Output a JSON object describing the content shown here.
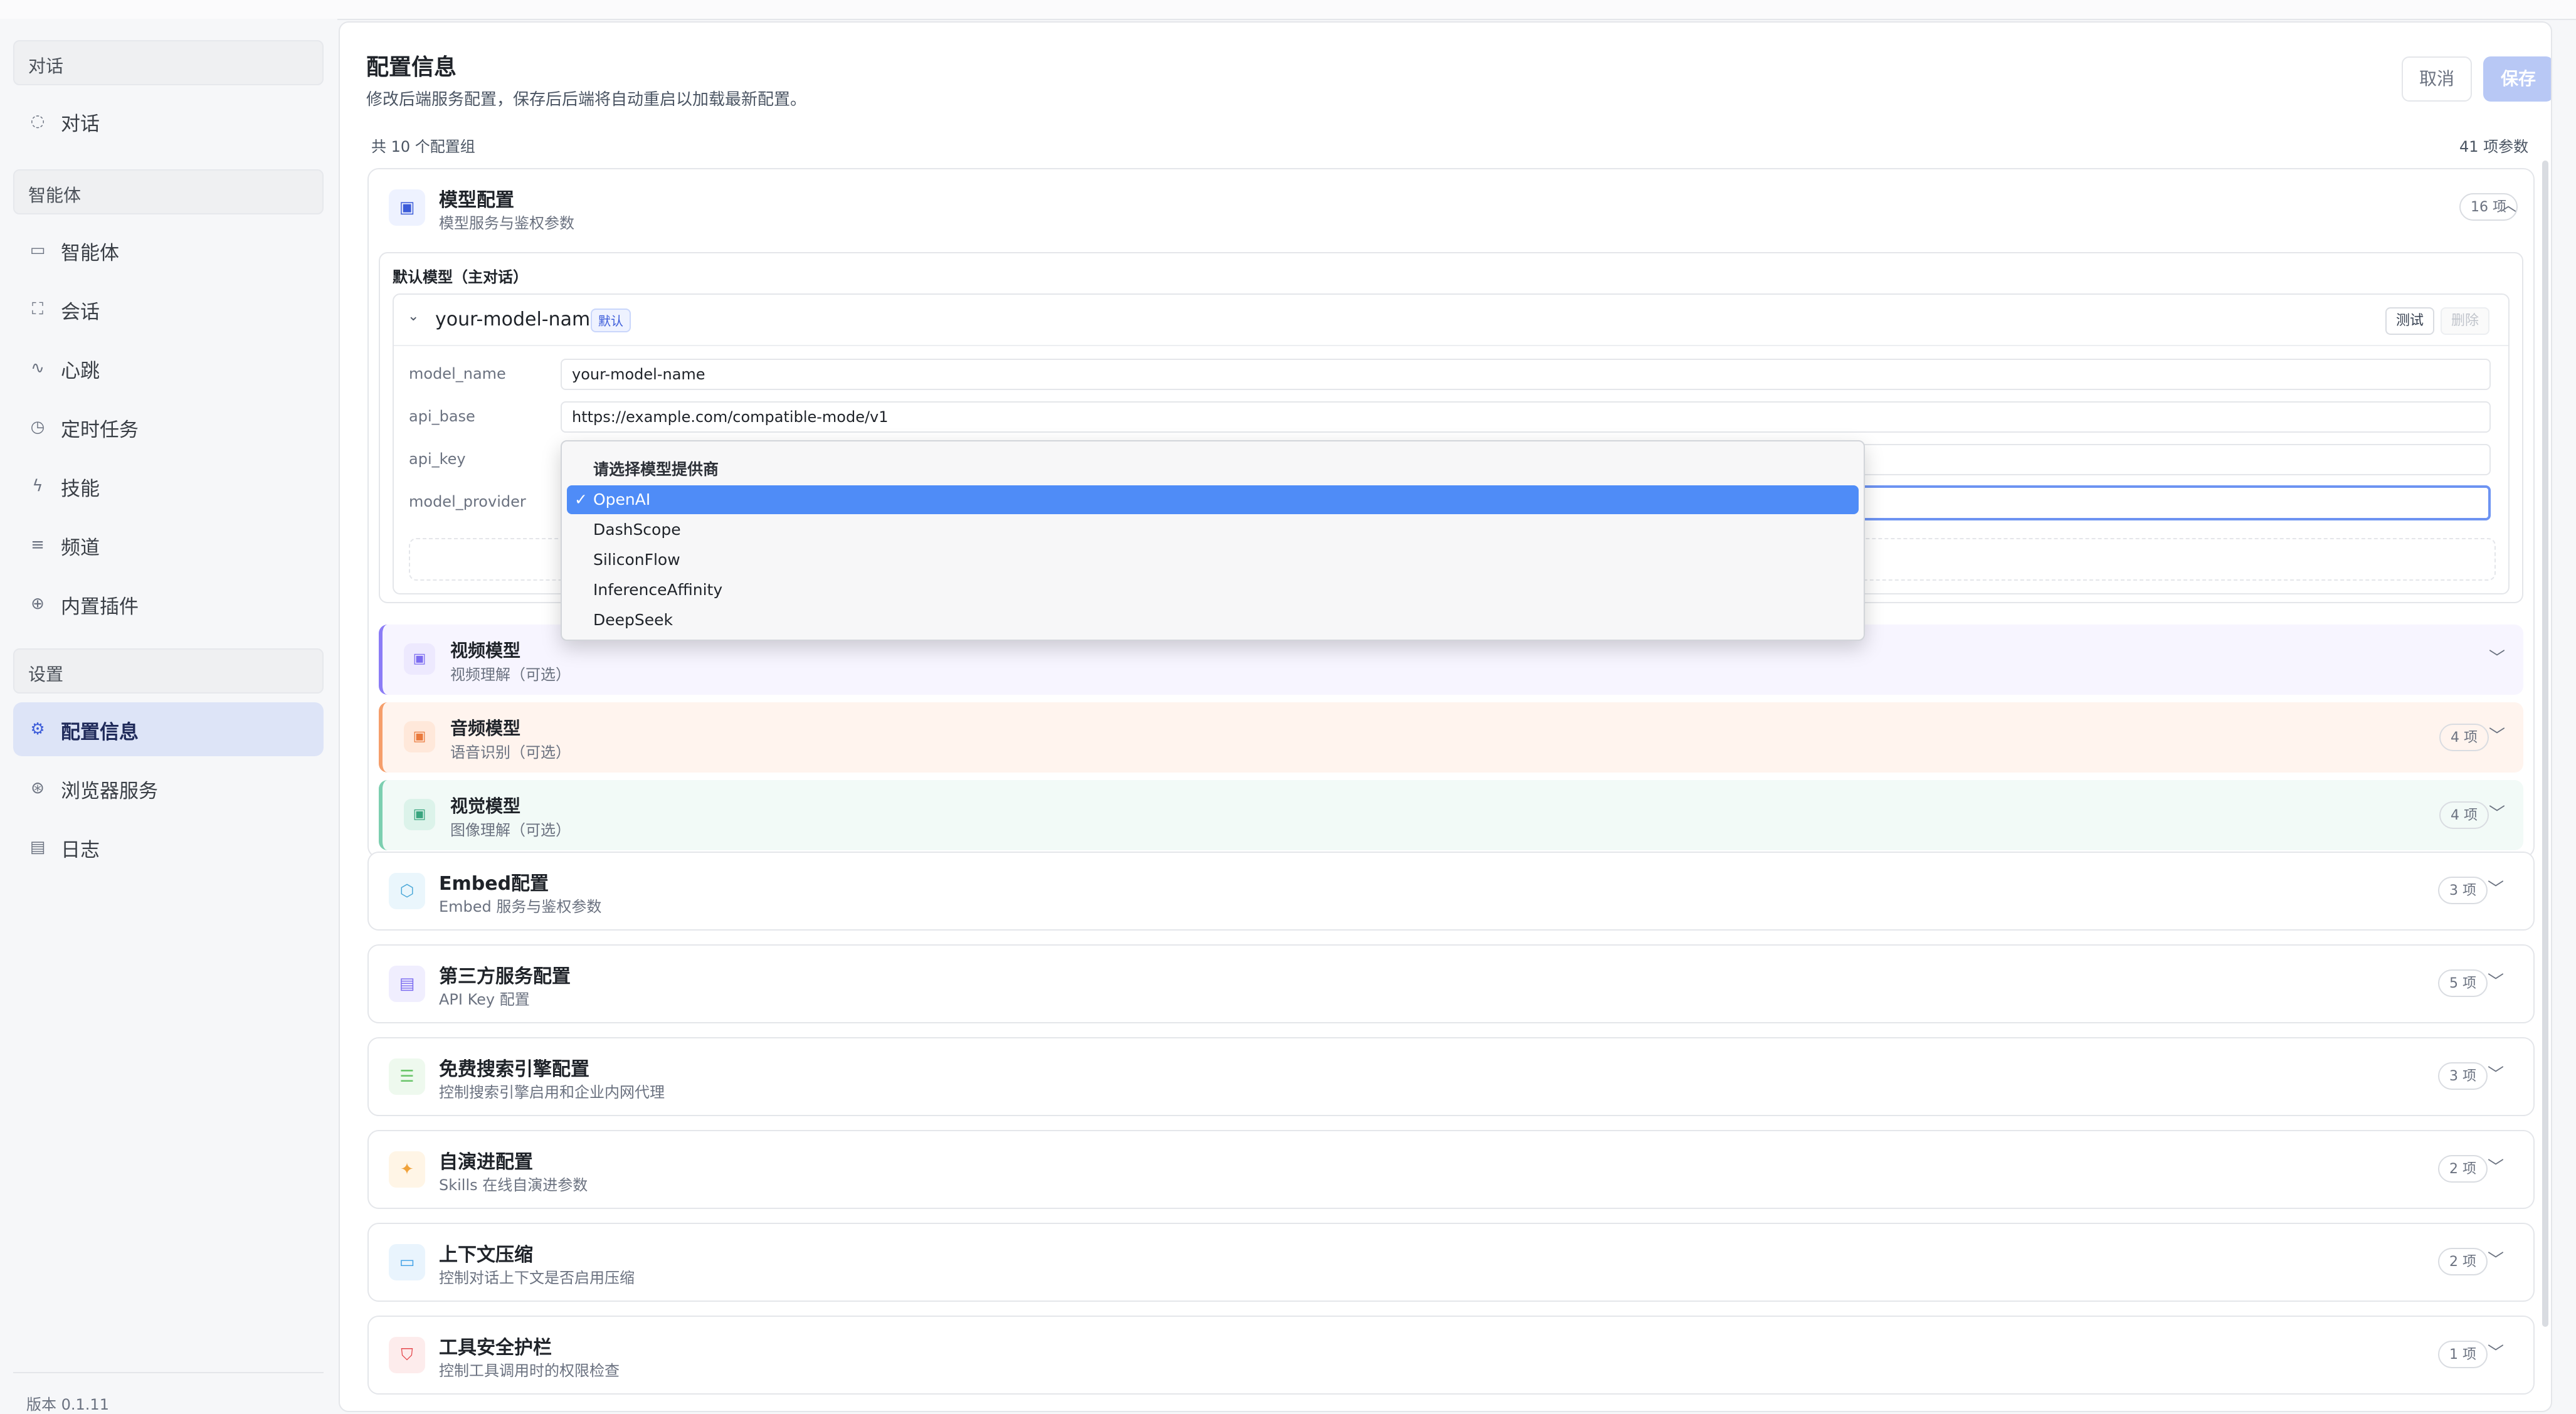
{
  "sidebar": {
    "groups": [
      "对话",
      "智能体",
      "设置"
    ],
    "items": [
      {
        "label": "对话",
        "icon": "chat-bubble-icon"
      },
      {
        "label": "智能体",
        "icon": "monitor-icon"
      },
      {
        "label": "会话",
        "icon": "session-scan-icon"
      },
      {
        "label": "心跳",
        "icon": "pulse-icon"
      },
      {
        "label": "定时任务",
        "icon": "clock-icon"
      },
      {
        "label": "技能",
        "icon": "lightning-icon"
      },
      {
        "label": "频道",
        "icon": "list-icon"
      },
      {
        "label": "内置插件",
        "icon": "plus-circle-icon"
      },
      {
        "label": "配置信息",
        "icon": "gear-icon",
        "active": true
      },
      {
        "label": "浏览器服务",
        "icon": "globe-icon"
      },
      {
        "label": "日志",
        "icon": "document-icon"
      }
    ],
    "version": "版本 0.1.11"
  },
  "header": {
    "title": "配置信息",
    "subtitle": "修改后端服务配置，保存后后端将自动重启以加载最新配置。",
    "cancel_label": "取消",
    "save_label": "保存",
    "group_count": "共 10 个配置组",
    "param_count": "41 项参数"
  },
  "model_section": {
    "title": "模型配置",
    "desc": "模型服务与鉴权参数",
    "badge": "16 项",
    "sub_label": "默认模型（主对话）",
    "model": {
      "name": "your-model-name",
      "tag": "默认",
      "test_label": "测试",
      "delete_label": "删除",
      "fields": [
        {
          "label": "model_name",
          "value": "your-model-name"
        },
        {
          "label": "api_base",
          "value": "https://example.com/compatible-mode/v1"
        },
        {
          "label": "api_key",
          "value": ""
        },
        {
          "label": "model_provider",
          "value": "OpenAI"
        }
      ]
    },
    "subsections": [
      {
        "title": "视频模型",
        "desc": "视频理解（可选）",
        "badge": "",
        "accent": "#8b7cf6",
        "bg": "#f7f5ff"
      },
      {
        "title": "音频模型",
        "desc": "语音识别（可选）",
        "badge": "4 项",
        "accent": "#f59e6b",
        "bg": "#fff4ee"
      },
      {
        "title": "视觉模型",
        "desc": "图像理解（可选）",
        "badge": "4 项",
        "accent": "#7ccfb0",
        "bg": "#f2faf7"
      }
    ]
  },
  "dropdown": {
    "header": "请选择模型提供商",
    "options": [
      "OpenAI",
      "DashScope",
      "SiliconFlow",
      "InferenceAffinity",
      "DeepSeek"
    ],
    "selected": "OpenAI"
  },
  "sections": [
    {
      "title": "Embed配置",
      "desc": "Embed 服务与鉴权参数",
      "badge": "3 项",
      "icon": "cube-icon",
      "color": "#4aa8d8",
      "bg": "#eaf6fc"
    },
    {
      "title": "第三方服务配置",
      "desc": "API Key 配置",
      "badge": "5 项",
      "icon": "message-card-icon",
      "color": "#7b6cf0",
      "bg": "#f0eefe"
    },
    {
      "title": "免费搜索引擎配置",
      "desc": "控制搜索引擎启用和企业内网代理",
      "badge": "3 项",
      "icon": "list-check-icon",
      "color": "#6ac56a",
      "bg": "#eef9ee"
    },
    {
      "title": "自演进配置",
      "desc": "Skills 在线自演进参数",
      "badge": "2 项",
      "icon": "sparkle-icon",
      "color": "#f0a23a",
      "bg": "#fff5e6"
    },
    {
      "title": "上下文压缩",
      "desc": "控制对话上下文是否启用压缩",
      "badge": "2 项",
      "icon": "monitor-icon",
      "color": "#3ea0e6",
      "bg": "#e9f4fd"
    },
    {
      "title": "工具安全护栏",
      "desc": "控制工具调用时的权限检查",
      "badge": "1 项",
      "icon": "shield-icon",
      "color": "#e5484d",
      "bg": "#fdecec"
    }
  ],
  "colors": {
    "accent": "#3b5bd9",
    "save_disabled": "#b8c8f5",
    "select_highlight": "#4f8cf7"
  }
}
